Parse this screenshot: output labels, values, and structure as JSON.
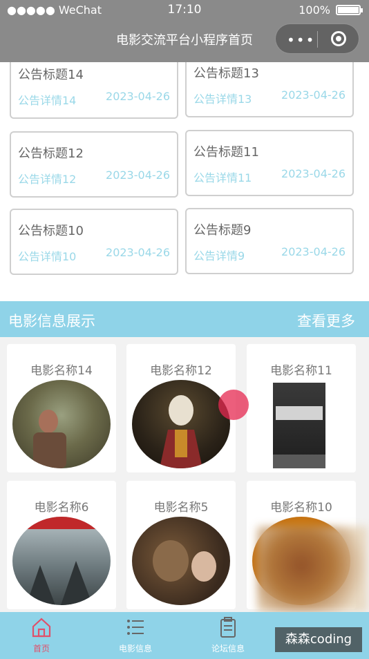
{
  "status_bar": {
    "carrier": "●●●●● WeChat",
    "time": "17:10",
    "battery": "100%"
  },
  "nav": {
    "title": "电影交流平台小程序首页",
    "capsule_more": "•••"
  },
  "notices": [
    {
      "title": "公告标题14",
      "detail": "公告详情14",
      "date": "2023-04-26"
    },
    {
      "title": "公告标题13",
      "detail": "公告详情13",
      "date": "2023-04-26"
    },
    {
      "title": "公告标题12",
      "detail": "公告详情12",
      "date": "2023-04-26"
    },
    {
      "title": "公告标题11",
      "detail": "公告详情11",
      "date": "2023-04-26"
    },
    {
      "title": "公告标题10",
      "detail": "公告详情10",
      "date": "2023-04-26"
    },
    {
      "title": "公告标题9",
      "detail": "公告详情9",
      "date": "2023-04-26"
    }
  ],
  "section": {
    "title": "电影信息展示",
    "more": "查看更多"
  },
  "movies": [
    {
      "name": "电影名称14"
    },
    {
      "name": "电影名称12"
    },
    {
      "name": "电影名称11"
    },
    {
      "name": "电影名称6"
    },
    {
      "name": "电影名称5"
    },
    {
      "name": "电影名称10"
    }
  ],
  "tabbar": {
    "home": "首页",
    "movie_info": "电影信息",
    "forum_info": "论坛信息"
  },
  "watermark": "森森coding",
  "colors": {
    "accent": "#8fd3e8",
    "accent_text": "#9ad8e8",
    "active_tab": "#e0506a",
    "nav_bg": "#8a8a8a"
  }
}
